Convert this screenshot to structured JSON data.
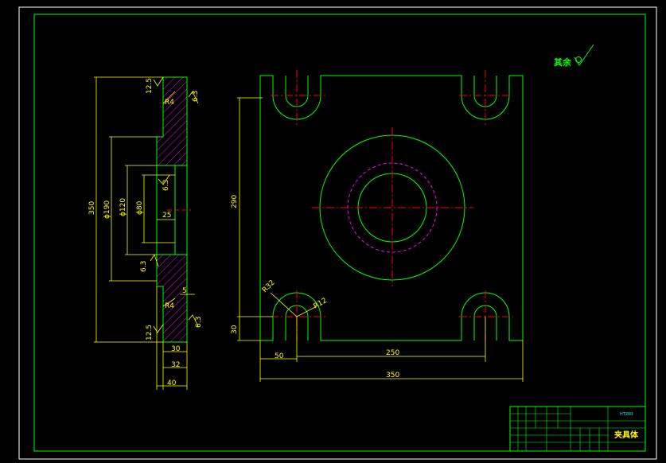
{
  "colors": {
    "background": "#000000",
    "border": "#ffffff",
    "outline": "#00ff00",
    "dimension": "#ffff00",
    "centerline": "#ff0000",
    "hidden": "#ff00ff",
    "hatch": "#ff00ff",
    "titleblock_text": "#00ffff"
  },
  "notes": {
    "surface_rest": "其余"
  },
  "side_view": {
    "roughness": [
      "12.5",
      "6.3",
      "6.3",
      "6.3",
      "12.5",
      "6.3"
    ],
    "dimensions": {
      "total_height": "350",
      "d190": "ϕ190",
      "d120": "ϕ120",
      "d80": "ϕ80",
      "depth": "25",
      "r4_top": "R4",
      "r4_bottom": "R4",
      "five": "5",
      "thirty": "30",
      "thirty_two": "32",
      "forty": "40"
    }
  },
  "front_view": {
    "dimensions": {
      "height_290": "290",
      "bottom_30": "30",
      "left_50": "50",
      "span_250": "250",
      "width_350": "350",
      "r32": "R32",
      "r12": "R12"
    }
  },
  "title_block": {
    "name": "夹具体",
    "material_code": "HT200"
  }
}
